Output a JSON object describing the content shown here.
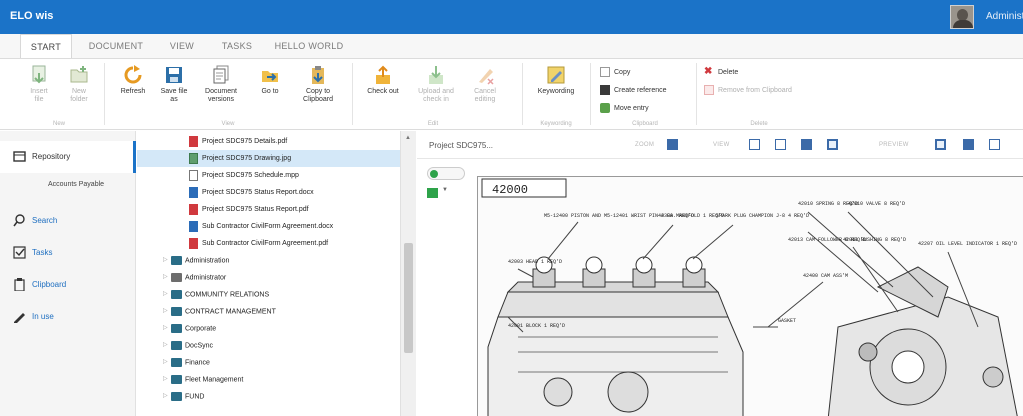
{
  "app": {
    "title": "ELO wis",
    "user": "Administrator",
    "avatar_icon": "user-avatar-photo"
  },
  "tabs": [
    "START",
    "DOCUMENT",
    "VIEW",
    "TASKS",
    "HELLO WORLD"
  ],
  "active_tab": "START",
  "ribbon": {
    "new": {
      "insert_file": "Insert file",
      "new_folder": "New folder",
      "group": "New"
    },
    "view": {
      "refresh": "Refresh",
      "save_file_as": "Save file as",
      "document_versions": "Document versions",
      "go_to": "Go to",
      "copy_to_clipboard": "Copy to Clipboard",
      "group": "View"
    },
    "edit": {
      "check_out": "Check out",
      "upload_check_in": "Upload and check in",
      "cancel_editing": "Cancel editing",
      "group": "Edit"
    },
    "keywording": {
      "label": "Keywording",
      "group": "Keywording"
    },
    "clipboard": {
      "copy": "Copy",
      "create_reference": "Create reference",
      "move_entry": "Move entry",
      "group": "Clipboard"
    },
    "delete": {
      "delete": "Delete",
      "remove_from_clipboard": "Remove from Clipboard",
      "group": "Delete"
    }
  },
  "nav": {
    "repository": "Repository",
    "accounts_payable": "Accounts Payable",
    "search": "Search",
    "tasks": "Tasks",
    "clipboard": "Clipboard",
    "in_use": "In use"
  },
  "tree": {
    "documents": [
      {
        "label": "Project SDC975 Details.pdf",
        "icon": "pdf-icon"
      },
      {
        "label": "Project SDC975 Drawing.jpg",
        "icon": "image-icon",
        "selected": true
      },
      {
        "label": "Project SDC975 Schedule.mpp",
        "icon": "document-icon"
      },
      {
        "label": "Project SDC975 Status Report.docx",
        "icon": "word-icon"
      },
      {
        "label": "Project SDC975 Status Report.pdf",
        "icon": "pdf-icon"
      },
      {
        "label": "Sub Contractor CivilForm Agreement.docx",
        "icon": "word-icon"
      },
      {
        "label": "Sub Contractor CivilForm Agreement.pdf",
        "icon": "pdf-icon"
      }
    ],
    "folders": [
      "Administration",
      "Administrator",
      "COMMUNITY RELATIONS",
      "CONTRACT MANAGEMENT",
      "Corporate",
      "DocSync",
      "Finance",
      "Fleet Management",
      "FUND"
    ]
  },
  "preview": {
    "title": "Project SDC975...",
    "zoom_label": "ZOOM",
    "view_label": "VIEW",
    "preview_label": "PREVIEW",
    "drawing": {
      "part_number": "42000",
      "labels": [
        {
          "t": "M5-12400 PISTON AND M5-12401 WRIST PIN 4 EA. REQ'D"
        },
        {
          "t": "42300 MANIFOLD 1 REQ'D"
        },
        {
          "t": "SPARK PLUG CHAMPION J-8 4 REQ'D"
        },
        {
          "t": "42010 SPRING 8 REQ'D"
        },
        {
          "t": "42010 VALVE 8 REQ'D"
        },
        {
          "t": "42003 HEAD 1 REQ'D"
        },
        {
          "t": "42013 CAM FOLLOWER 8 REQ'D"
        },
        {
          "t": "42011 BUSHING 8 REQ'D"
        },
        {
          "t": "42207 OIL LEVEL INDICATOR 1 REQ'D"
        },
        {
          "t": "42400 CAM ASS'M"
        },
        {
          "t": "42001 BLOCK 1 REQ'D"
        },
        {
          "t": "GASKET"
        }
      ]
    }
  },
  "colors": {
    "accent": "#1b73c8",
    "selection": "#d4e8f8",
    "folder": "#2a6d87",
    "pdf": "#d0393e"
  }
}
